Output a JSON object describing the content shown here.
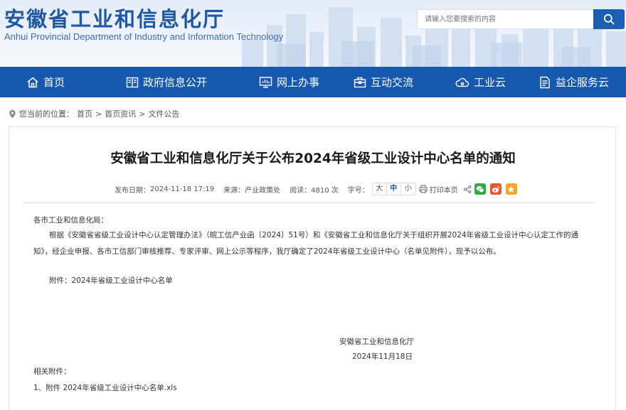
{
  "header": {
    "title": "安徽省工业和信息化厅",
    "subtitle": "Anhui Provincial Department of Industry and Information Technology",
    "search_placeholder": "请输入您要搜索的内容"
  },
  "nav": [
    {
      "label": "首页",
      "icon": "home-icon"
    },
    {
      "label": "政府信息公开",
      "icon": "book-icon"
    },
    {
      "label": "网上办事",
      "icon": "monitor-icon"
    },
    {
      "label": "互动交流",
      "icon": "briefcase-icon"
    },
    {
      "label": "工业云",
      "icon": "cloud-icon"
    },
    {
      "label": "益企服务云",
      "icon": "document-icon"
    }
  ],
  "breadcrumb": {
    "prefix": "您当前的位置：",
    "items": [
      "首页",
      "首页资讯",
      "文件公告"
    ],
    "separator": ">"
  },
  "article": {
    "title": "安徽省工业和信息化厅关于公布2024年省级工业设计中心名单的通知",
    "meta": {
      "date_label": "发布日期：",
      "date": "2024-11-18 17:19",
      "source_label": "来源：",
      "source": "产业政策处",
      "views_label": "阅读：",
      "views": "4810 次",
      "font_label": "字号：",
      "font_sizes": [
        "大",
        "中",
        "小"
      ],
      "print": "打印本页"
    },
    "salutation": "各市工业和信息化局：",
    "paragraph_line1": "根据《安徽省省级工业设计中心认定管理办法》（皖工信产业函〔2024〕51号）和《安徽省工业和信息化厅关于组织开展2024年省级工业设计中心认定工作的通",
    "paragraph_line2": "知》，经企业申报、各市工信部门审核推荐、专家评审、网上公示等程序，我厅确定了2024年省级工业设计中心（名单见附件），现予以公布。",
    "attachment_note": "附件：2024年省级工业设计中心名单",
    "signature_org": "安徽省工业和信息化厅",
    "signature_date": "2024年11月18日",
    "related_label": "相关附件：",
    "attachment_link": "1、附件 2024年省级工业设计中心名单.xls"
  },
  "colors": {
    "nav_bg": "#1658ae",
    "title_blue": "#1f57a6",
    "wechat": "#2aae3c",
    "weibo": "#e6592e",
    "qzone": "#f5a623"
  }
}
